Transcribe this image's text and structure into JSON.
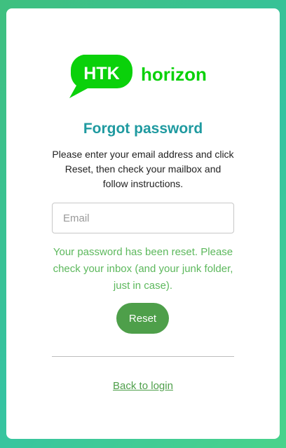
{
  "logo": {
    "badge_text": "HTK",
    "word_text": "horizon"
  },
  "form": {
    "title": "Forgot password",
    "instructions": "Please enter your email address and click Reset, then check your mailbox and follow instructions.",
    "email_placeholder": "Email",
    "email_value": "",
    "success_message": "Your password has been reset. Please check your inbox (and your junk folder, just in case).",
    "reset_label": "Reset",
    "back_link_label": "Back to login"
  },
  "colors": {
    "brand_green": "#0ad10a",
    "title_teal": "#1f9aa0",
    "success_green": "#5cb85c",
    "button_green": "#4e9f4a"
  }
}
